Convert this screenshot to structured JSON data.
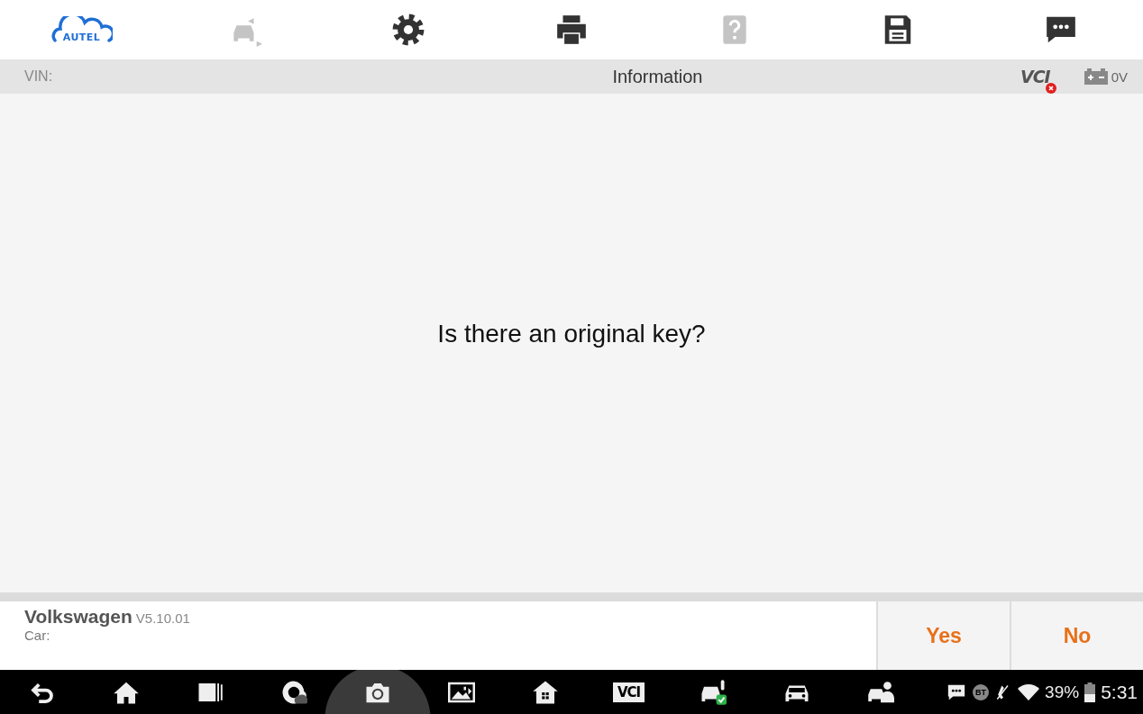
{
  "toolbar": [
    {
      "kind": "logo",
      "label": "AUTEL",
      "disabled": false
    },
    {
      "kind": "car-swap",
      "disabled": true
    },
    {
      "kind": "settings",
      "disabled": false
    },
    {
      "kind": "print",
      "disabled": false
    },
    {
      "kind": "help",
      "disabled": true
    },
    {
      "kind": "save",
      "disabled": false
    },
    {
      "kind": "chat",
      "disabled": false
    }
  ],
  "info_bar": {
    "vin_label": "VIN:",
    "title": "Information",
    "vci": {
      "label": "VCI",
      "connected": false
    },
    "battery_reading": "0V"
  },
  "message": "Is there an original key?",
  "footer": {
    "make": "Volkswagen",
    "version": "V5.10.01",
    "car_label": "Car:",
    "buttons": [
      "Yes",
      "No"
    ]
  },
  "nav": [
    {
      "kind": "back",
      "highlighted": false
    },
    {
      "kind": "home",
      "highlighted": false
    },
    {
      "kind": "recents",
      "highlighted": false
    },
    {
      "kind": "cloud",
      "highlighted": false
    },
    {
      "kind": "camera",
      "highlighted": true
    },
    {
      "kind": "display",
      "highlighted": false
    },
    {
      "kind": "house",
      "highlighted": false
    },
    {
      "kind": "vci",
      "label": "VCI",
      "highlighted": false
    },
    {
      "kind": "car-key",
      "highlighted": false
    },
    {
      "kind": "car",
      "highlighted": false
    },
    {
      "kind": "car-person",
      "highlighted": false
    }
  ],
  "status": {
    "bt": "BT",
    "battery": "39%",
    "time": "5:31"
  }
}
